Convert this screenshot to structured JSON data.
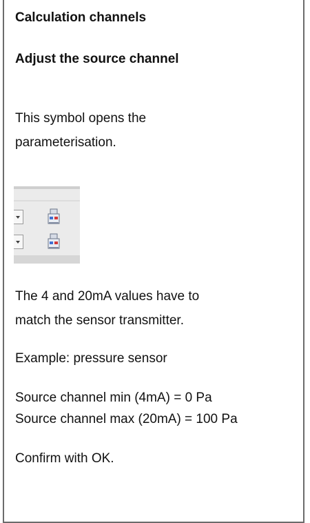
{
  "heading": "Calculation channels",
  "subheading": "Adjust the source channel",
  "intro": [
    "This symbol opens the",
    "parameterisation."
  ],
  "toolbar_snippet": {
    "rows": [
      {
        "dropdown_icon": "chevron-down-icon",
        "button_icon": "sensor-device-icon"
      },
      {
        "dropdown_icon": "chevron-down-icon",
        "button_icon": "sensor-device-icon"
      }
    ]
  },
  "note": [
    "The 4 and 20mA values have to",
    "match the sensor transmitter."
  ],
  "example": "Example: pressure sensor",
  "source_min": "Source channel min (4mA) = 0 Pa",
  "source_max": "Source channel max (20mA) = 100 Pa",
  "confirm": "Confirm with OK.",
  "colors": {
    "border": "#6b6b6b",
    "text": "#111111",
    "device_blue": "#3f6fd0",
    "device_red": "#d23a3a"
  }
}
